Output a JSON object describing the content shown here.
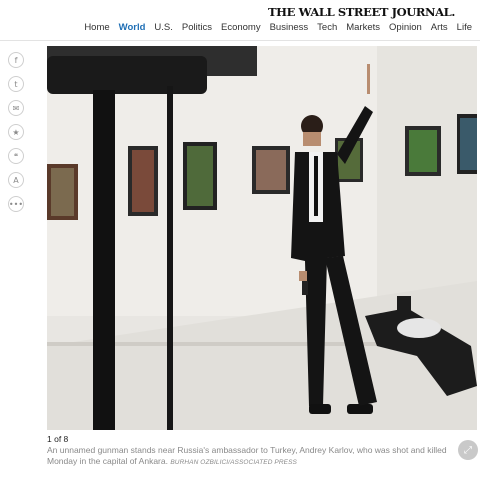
{
  "masthead": {
    "title": "THE WALL STREET JOURNAL."
  },
  "nav": {
    "items": [
      "Home",
      "World",
      "U.S.",
      "Politics",
      "Economy",
      "Business",
      "Tech",
      "Markets",
      "Opinion",
      "Arts",
      "Life"
    ],
    "active": "World",
    "active_color": "#1f6fb5"
  },
  "share": {
    "icons": [
      "facebook-icon",
      "twitter-icon",
      "email-icon",
      "bookmark-star-icon",
      "comment-icon",
      "text-size-icon",
      "more-icon"
    ],
    "glyphs": [
      "f",
      "t",
      "✉",
      "★",
      "❝",
      "A",
      "•••"
    ]
  },
  "slideshow": {
    "counter": "1 of 8",
    "caption": "An unnamed gunman stands near Russia's ambassador to Turkey, Andrey Karlov, who was shot and killed Monday in the capital of Ankara.",
    "credit": "BURHAN OZBILICI/ASSOCIATED PRESS",
    "expand_icon": "expand-icon",
    "expand_glyph": "⤢"
  }
}
